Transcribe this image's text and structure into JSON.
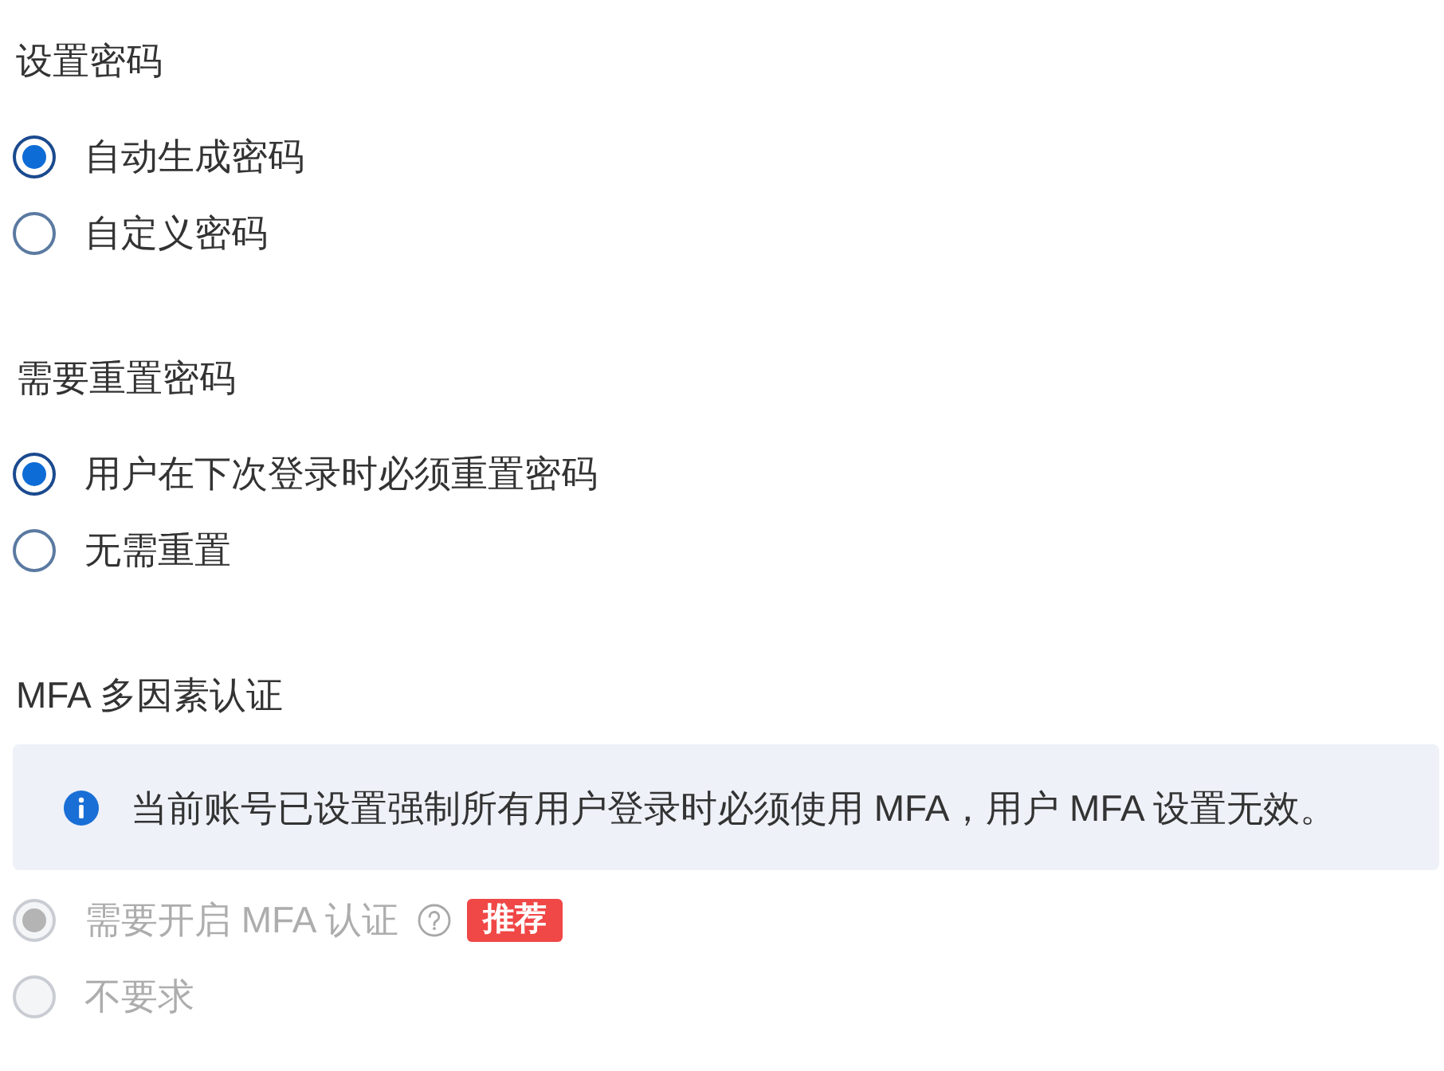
{
  "sections": [
    {
      "title": "设置密码",
      "options": [
        {
          "label": "自动生成密码",
          "selected": true,
          "disabled": false
        },
        {
          "label": "自定义密码",
          "selected": false,
          "disabled": false
        }
      ]
    },
    {
      "title": "需要重置密码",
      "options": [
        {
          "label": "用户在下次登录时必须重置密码",
          "selected": true,
          "disabled": false
        },
        {
          "label": "无需重置",
          "selected": false,
          "disabled": false
        }
      ]
    },
    {
      "title": "MFA 多因素认证",
      "notice": {
        "text": "当前账号已设置强制所有用户登录时必须使用 MFA，用户 MFA 设置无效。"
      },
      "options": [
        {
          "label": "需要开启 MFA 认证",
          "selected": true,
          "disabled": true,
          "help": true,
          "badge": "推荐"
        },
        {
          "label": "不要求",
          "selected": false,
          "disabled": true
        }
      ]
    }
  ]
}
